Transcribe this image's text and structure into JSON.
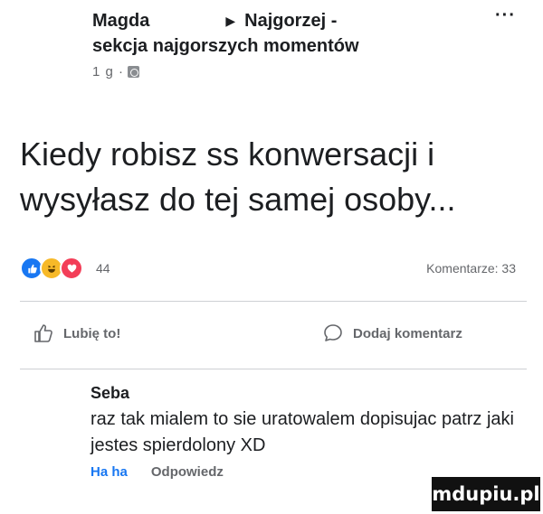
{
  "post": {
    "author": "Magda",
    "group_line1": "Najgorzej -",
    "group_line2": "sekcja najgorszych momentów",
    "more_label": "···",
    "time": "1 g ·",
    "text": "Kiedy robisz ss konwersacji i wysyłasz do tej samej osoby...",
    "reactions_count": "44",
    "comments_count": "Komentarze: 33"
  },
  "actions": {
    "like_label": "Lubię to!",
    "comment_label": "Dodaj komentarz"
  },
  "comment": {
    "author": "Seba",
    "text": "raz tak mialem to sie uratowalem dopisujac patrz jaki jestes spierdolony XD",
    "haha_label": "Ha ha",
    "reply_label": "Odpowiedz"
  },
  "icons": [
    "arrow-right-icon",
    "more-icon",
    "group-icon",
    "like-reaction-icon",
    "haha-reaction-icon",
    "love-reaction-icon",
    "like-icon",
    "comment-icon"
  ],
  "colors": {
    "accent": "#1877f2",
    "secondary_text": "#65676b",
    "watermark_bg": "#111111"
  },
  "watermark": "mdupiu.pl"
}
